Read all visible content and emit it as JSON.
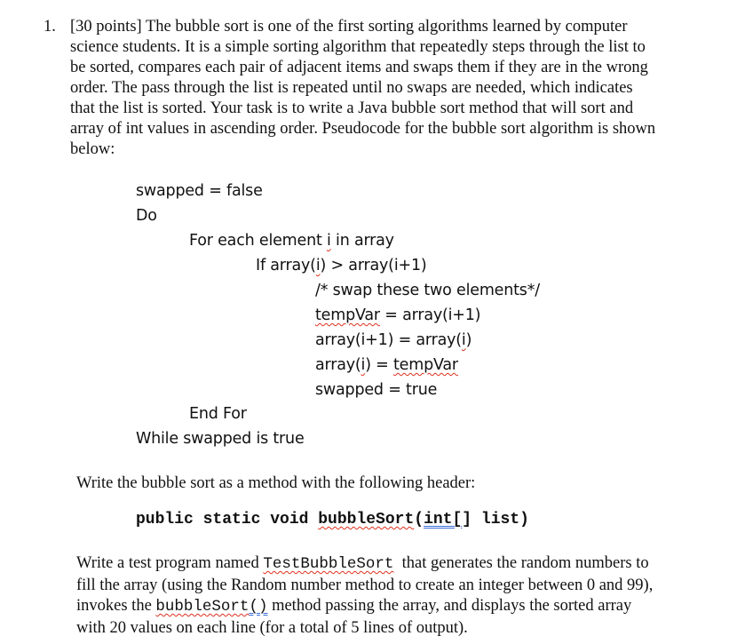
{
  "question": {
    "number": "1.",
    "intro_lines": [
      "[30 points] The bubble sort is one of the first sorting algorithms learned by computer",
      "science students. It is a simple sorting algorithm that repeatedly steps through the list to",
      "be sorted, compares each pair of adjacent items and swaps them if they are in the wrong",
      "order. The pass through the list is repeated until no swaps are needed, which indicates",
      "that the list is sorted. Your task is to write a Java bubble sort method that will sort and",
      "array of int values in ascending order. Pseudocode for the bubble sort algorithm is shown",
      "below:"
    ]
  },
  "pseudocode": {
    "line1": "swapped = false",
    "line2": "Do",
    "line3_pre": "For each element ",
    "line3_i": "i",
    "line3_post": " in array",
    "line4_pre": "If array(",
    "line4_i": "i",
    "line4_post": ") > array(i+1)",
    "line5": "/* swap these two elements*/",
    "line6_var": "tempVar",
    "line6_post": " = array(i+1)",
    "line7_pre": "array(i+1) = array(",
    "line7_i": "i",
    "line7_post": ")",
    "line8_pre": "array(",
    "line8_i": "i",
    "line8_mid": ") = ",
    "line8_var": "tempVar",
    "line9": "swapped = true",
    "line10": "End For",
    "line11": "While swapped is true"
  },
  "method_intro": "Write the bubble sort as a method with the following header:",
  "signature": {
    "pre": "public static void ",
    "name": "bubbleSort",
    "paren_open": "(",
    "type": "int[",
    "post": "] list)"
  },
  "test_program": {
    "line1_pre": "Write a test program named ",
    "line1_code": "TestBubbleSort",
    "line1_post": "  that generates the random numbers to",
    "line2": "fill the array (using the Random number method to create an integer between 0 and 99),",
    "line3_pre": "invokes the ",
    "line3_code": "bubbleSort",
    "line3_code2": "()",
    "line3_post": " method passing the array, and displays the sorted array",
    "line4": "with 20 values on each line (for a total of 5 lines of output)."
  }
}
